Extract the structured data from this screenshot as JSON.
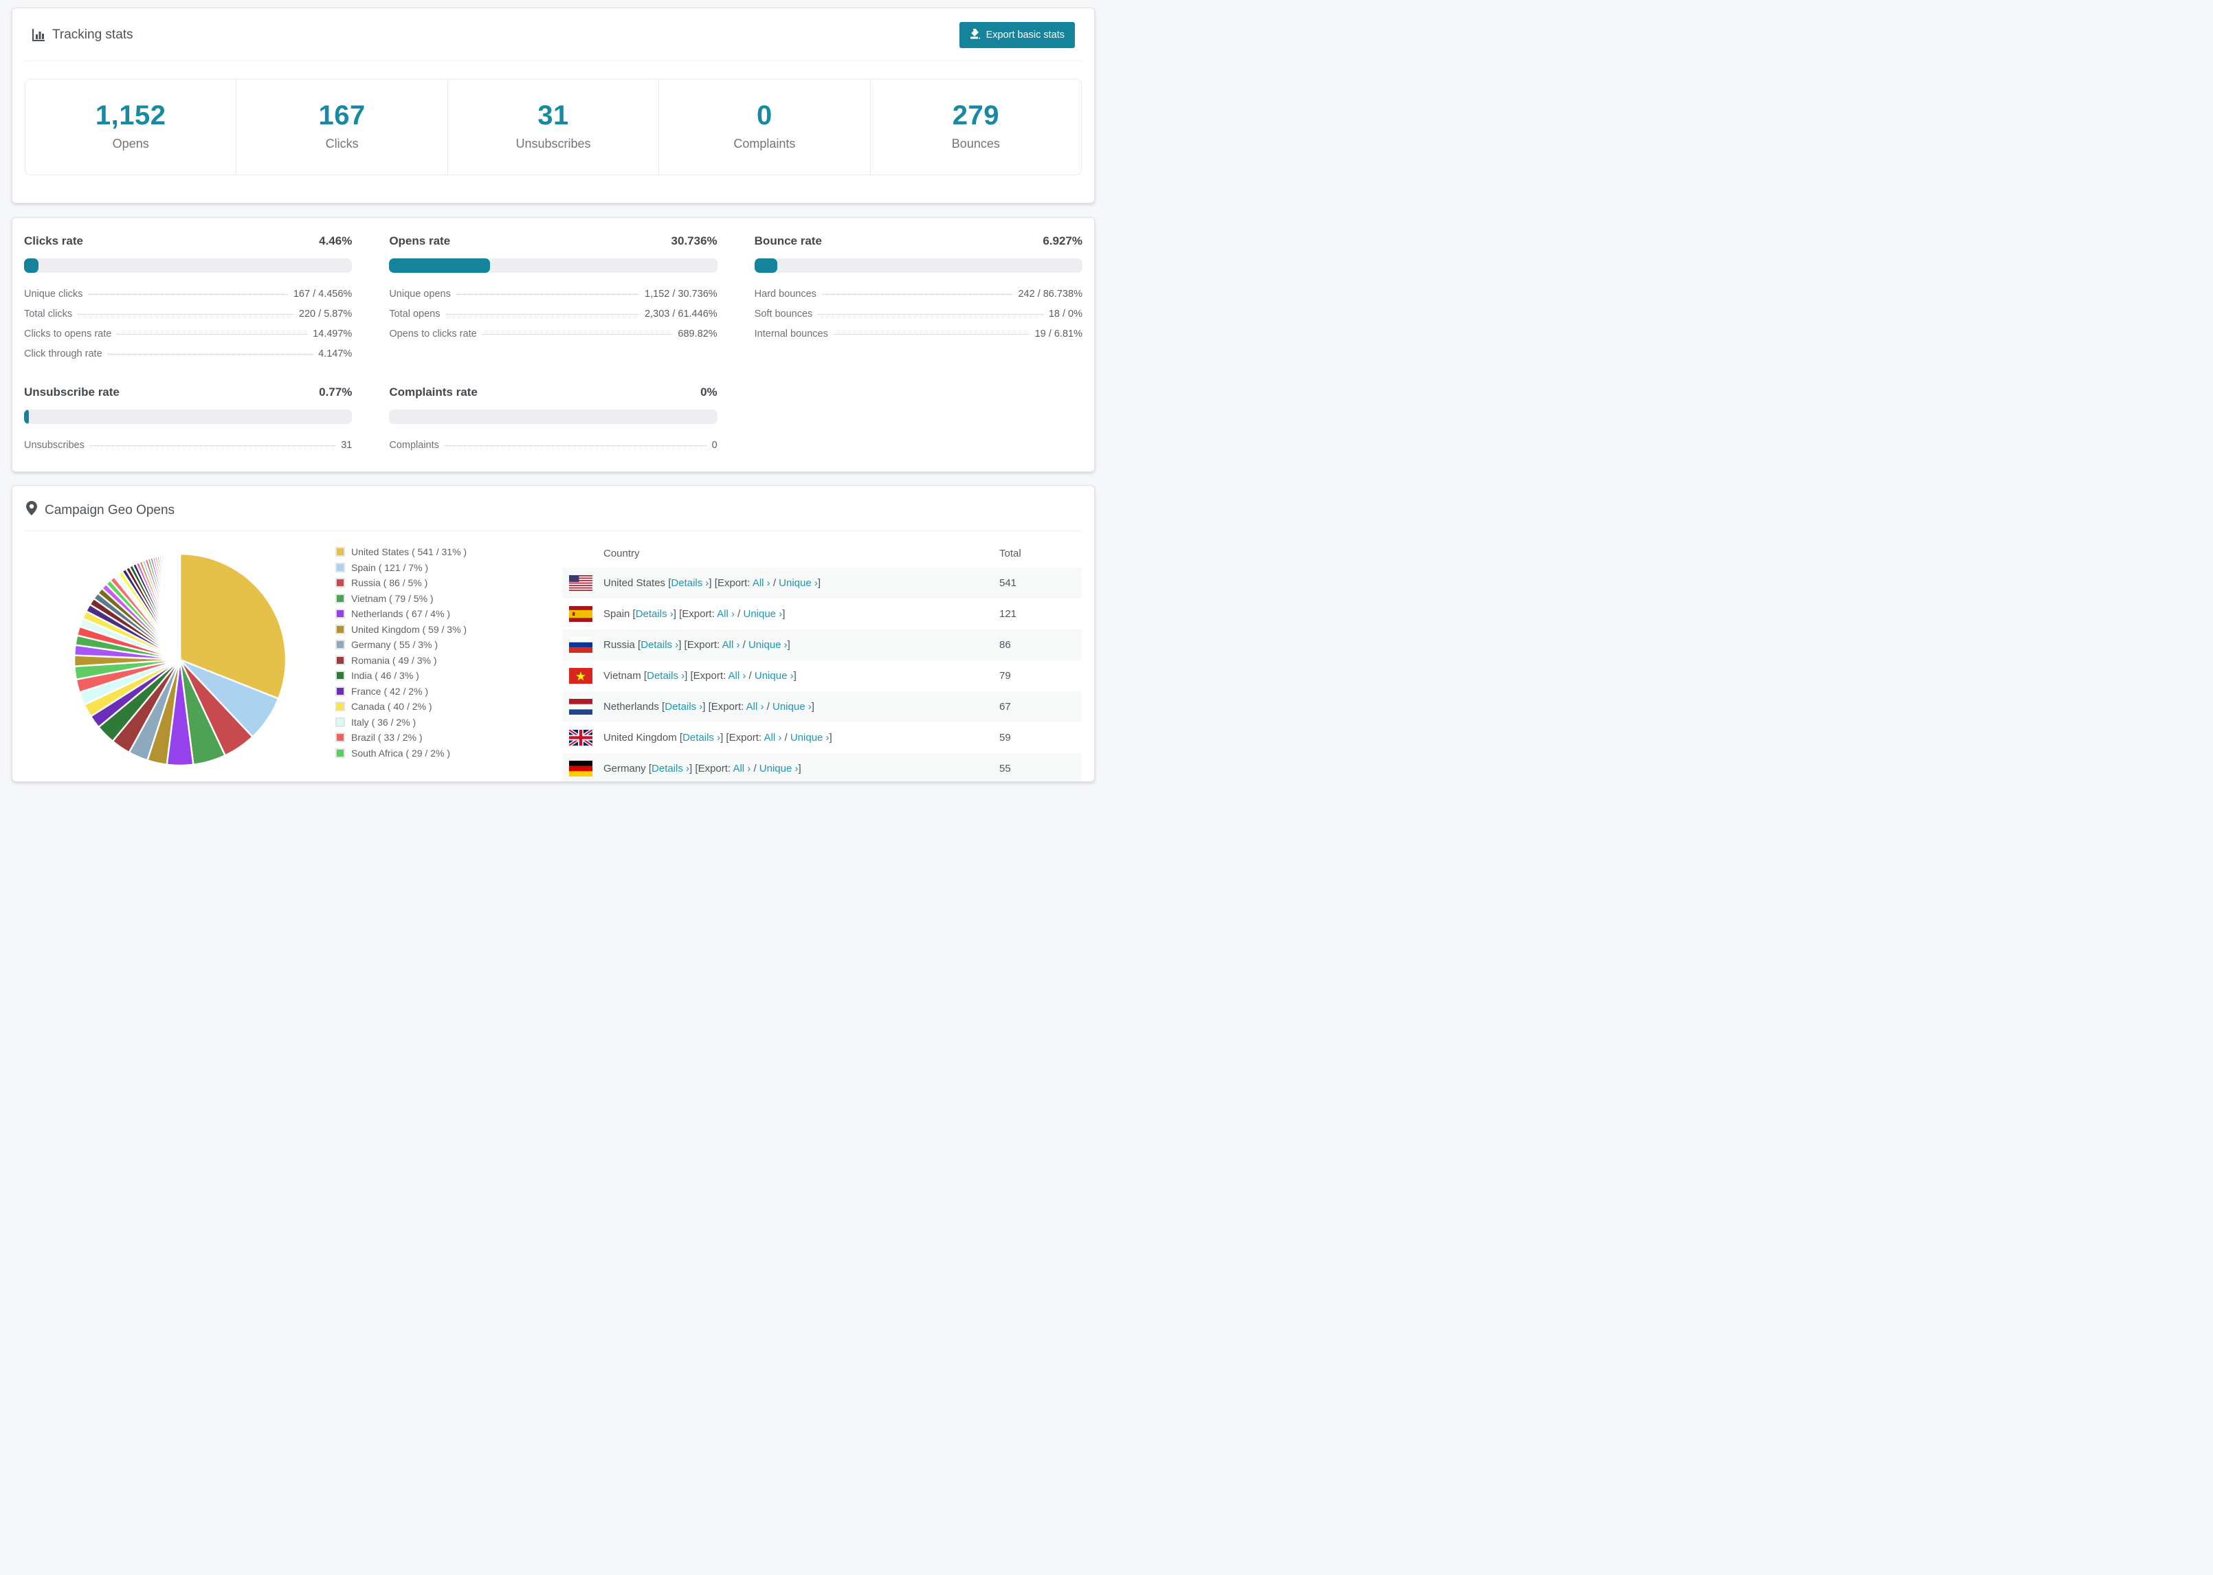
{
  "accent": "#15839B",
  "link_color": "#1f97B3",
  "tracking": {
    "title": "Tracking stats",
    "export_button": "Export basic stats",
    "stats": [
      {
        "value": "1,152",
        "label": "Opens"
      },
      {
        "value": "167",
        "label": "Clicks"
      },
      {
        "value": "31",
        "label": "Unsubscribes"
      },
      {
        "value": "0",
        "label": "Complaints"
      },
      {
        "value": "279",
        "label": "Bounces"
      }
    ]
  },
  "rates": {
    "blocks": [
      {
        "key": "clicks",
        "title": "Clicks rate",
        "percent": "4.46%",
        "bar": 4.46,
        "rows": [
          {
            "label": "Unique clicks",
            "value": "167 / 4.456%"
          },
          {
            "label": "Total clicks",
            "value": "220 / 5.87%"
          },
          {
            "label": "Clicks to opens rate",
            "value": "14.497%"
          },
          {
            "label": "Click through rate",
            "value": "4.147%"
          }
        ]
      },
      {
        "key": "opens",
        "title": "Opens rate",
        "percent": "30.736%",
        "bar": 30.736,
        "rows": [
          {
            "label": "Unique opens",
            "value": "1,152 / 30.736%"
          },
          {
            "label": "Total opens",
            "value": "2,303 / 61.446%"
          },
          {
            "label": "Opens to clicks rate",
            "value": "689.82%"
          }
        ]
      },
      {
        "key": "bounce",
        "title": "Bounce rate",
        "percent": "6.927%",
        "bar": 6.927,
        "rows": [
          {
            "label": "Hard bounces",
            "value": "242 / 86.738%"
          },
          {
            "label": "Soft bounces",
            "value": "18 / 0%"
          },
          {
            "label": "Internal bounces",
            "value": "19 / 6.81%"
          }
        ]
      },
      {
        "key": "unsubscribe",
        "title": "Unsubscribe rate",
        "percent": "0.77%",
        "bar": 0.77,
        "rows": [
          {
            "label": "Unsubscribes",
            "value": "31"
          }
        ]
      },
      {
        "key": "complaints",
        "title": "Complaints rate",
        "percent": "0%",
        "bar": 0,
        "rows": [
          {
            "label": "Complaints",
            "value": "0"
          }
        ]
      }
    ]
  },
  "geo": {
    "title": "Campaign Geo Opens",
    "links": {
      "details": "Details ›",
      "export_prefix": "Export:",
      "all": "All ›",
      "unique": "Unique ›"
    },
    "table": {
      "headers": [
        "Country",
        "Total"
      ],
      "rows": [
        {
          "country": "United States",
          "flag": "us",
          "total": "541"
        },
        {
          "country": "Spain",
          "flag": "es",
          "total": "121"
        },
        {
          "country": "Russia",
          "flag": "ru",
          "total": "86"
        },
        {
          "country": "Vietnam",
          "flag": "vn",
          "total": "79"
        },
        {
          "country": "Netherlands",
          "flag": "nl",
          "total": "67"
        },
        {
          "country": "United Kingdom",
          "flag": "gb",
          "total": "59"
        },
        {
          "country": "Germany",
          "flag": "de",
          "total": "55"
        }
      ]
    }
  },
  "chart_data": {
    "type": "pie",
    "title": "Campaign Geo Opens",
    "legend_position": "right",
    "slices": [
      {
        "name": "United States",
        "count": 541,
        "percent": 31,
        "color": "#E5C14A",
        "label": "United States ( 541 / 31% )"
      },
      {
        "name": "Spain",
        "count": 121,
        "percent": 7,
        "color": "#ABD3F0",
        "label": "Spain ( 121 / 7% )"
      },
      {
        "name": "Russia",
        "count": 86,
        "percent": 5,
        "color": "#C74A4E",
        "label": "Russia ( 86 / 5% )"
      },
      {
        "name": "Vietnam",
        "count": 79,
        "percent": 5,
        "color": "#4EA253",
        "label": "Vietnam ( 79 / 5% )"
      },
      {
        "name": "Netherlands",
        "count": 67,
        "percent": 4,
        "color": "#9640EE",
        "label": "Netherlands ( 67 / 4% )"
      },
      {
        "name": "United Kingdom",
        "count": 59,
        "percent": 3,
        "color": "#B3922F",
        "label": "United Kingdom ( 59 / 3% )"
      },
      {
        "name": "Germany",
        "count": 55,
        "percent": 3,
        "color": "#8CA9C0",
        "label": "Germany ( 55 / 3% )"
      },
      {
        "name": "Romania",
        "count": 49,
        "percent": 3,
        "color": "#9E3B3B",
        "label": "Romania ( 49 / 3% )"
      },
      {
        "name": "India",
        "count": 46,
        "percent": 3,
        "color": "#2F7A36",
        "label": "India ( 46 / 3% )"
      },
      {
        "name": "France",
        "count": 42,
        "percent": 2,
        "color": "#6A2EB8",
        "label": "France ( 42 / 2% )"
      },
      {
        "name": "Canada",
        "count": 40,
        "percent": 2,
        "color": "#FAE14E",
        "label": "Canada ( 40 / 2% )"
      },
      {
        "name": "Italy",
        "count": 36,
        "percent": 2,
        "color": "#D9FBF7",
        "label": "Italy ( 36 / 2% )"
      },
      {
        "name": "Brazil",
        "count": 33,
        "percent": 2,
        "color": "#F26060",
        "label": "Brazil ( 33 / 2% )"
      },
      {
        "name": "South Africa",
        "count": 29,
        "percent": 2,
        "color": "#5FCB63",
        "label": "South Africa ( 29 / 2% )"
      }
    ],
    "others_total_percent": 26,
    "others_palette": [
      "#B8962E",
      "#A855F7",
      "#4CAF50",
      "#F05050",
      "#DFF9F7",
      "#F7E94F",
      "#4B2E83",
      "#7E2A2A",
      "#5E7A8A",
      "#7A6A1E",
      "#C95CF0",
      "#5AD85A",
      "#FA6A6A",
      "#EFFAFD",
      "#FAFA55",
      "#3A2A7E",
      "#6E1E1E",
      "#1E5E2E",
      "#28285E",
      "#E055E0",
      "#C89A30",
      "#A8CBF0",
      "#E04848",
      "#48B048",
      "#9048E0",
      "#FF69B4"
    ]
  }
}
